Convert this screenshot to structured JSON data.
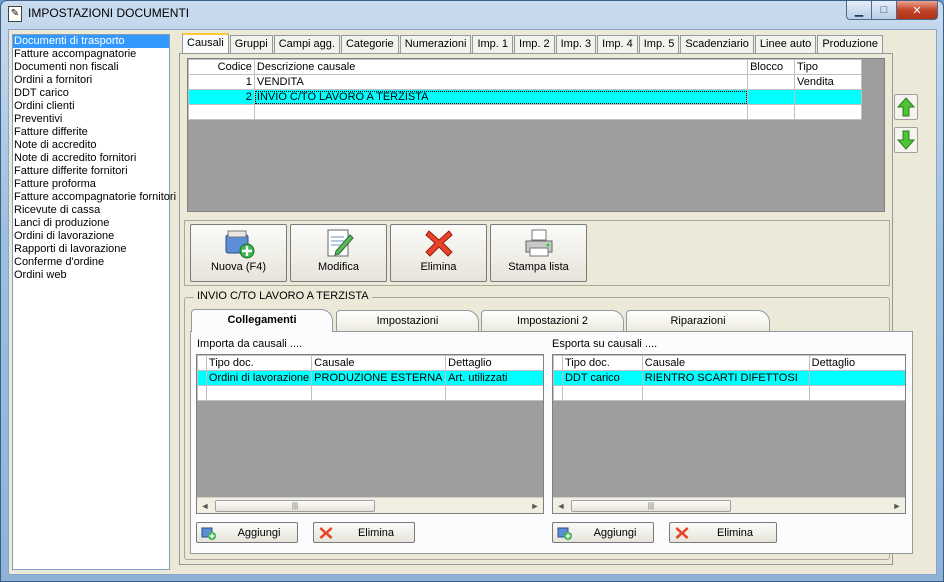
{
  "window": {
    "title": "IMPOSTAZIONI DOCUMENTI",
    "minimize_glyph": "▁",
    "maximize_glyph": "□",
    "close_glyph": "✕"
  },
  "doc_types": [
    "Documenti di trasporto",
    "Fatture accompagnatorie",
    "Documenti non fiscali",
    "Ordini a fornitori",
    "DDT carico",
    "Ordini clienti",
    "Preventivi",
    "Fatture differite",
    "Note di accredito",
    "Note di accredito fornitori",
    "Fatture differite fornitori",
    "Fatture proforma",
    "Fatture accompagnatorie fornitori",
    "Ricevute di cassa",
    "Lanci di produzione",
    "Ordini di lavorazione",
    "Rapporti di lavorazione",
    "Conferme d'ordine",
    "Ordini web"
  ],
  "selected_doc_type": "Documenti di trasporto",
  "tabs": [
    "Causali",
    "Gruppi",
    "Campi agg.",
    "Categorie",
    "Numerazioni",
    "Imp. 1",
    "Imp. 2",
    "Imp. 3",
    "Imp. 4",
    "Imp. 5",
    "Scadenziario",
    "Linee auto",
    "Produzione"
  ],
  "active_tab": "Causali",
  "causali": {
    "columns": [
      "Codice",
      "Descrizione causale",
      "Blocco",
      "Tipo"
    ],
    "rows": [
      {
        "codice": "1",
        "descrizione": "VENDITA",
        "blocco": "",
        "tipo": "Vendita"
      },
      {
        "codice": "2",
        "descrizione": "INVIO C/TO LAVORO A TERZISTA",
        "blocco": "",
        "tipo": ""
      }
    ]
  },
  "toolbar": {
    "nuova": "Nuova (F4)",
    "modifica": "Modifica",
    "elimina": "Elimina",
    "stampa": "Stampa lista"
  },
  "group_title": "INVIO C/TO LAVORO A TERZISTA",
  "subtabs": [
    "Collegamenti",
    "Impostazioni",
    "Impostazioni 2",
    "Riparazioni"
  ],
  "active_subtab": "Collegamenti",
  "importa": {
    "label": "Importa da causali ....",
    "columns": [
      "Tipo doc.",
      "Causale",
      "Dettaglio"
    ],
    "rows": [
      {
        "tipo": "Ordini di lavorazione",
        "causale": "PRODUZIONE ESTERNA",
        "dettaglio": "Art. utilizzati"
      }
    ],
    "add": "Aggiungi",
    "remove": "Elimina"
  },
  "esporta": {
    "label": "Esporta su causali ....",
    "columns": [
      "Tipo doc.",
      "Causale",
      "Dettaglio"
    ],
    "rows": [
      {
        "tipo": "DDT carico",
        "causale": "RIENTRO SCARTI DIFETTOSI",
        "dettaglio": ""
      }
    ],
    "add": "Aggiungi",
    "remove": "Elimina"
  },
  "scroll_glyphs": {
    "left": "◄",
    "right": "►",
    "grip": "|||"
  },
  "colors": {
    "selection": "#3399ff",
    "row_highlight": "#00ffff",
    "tab_accent": "#ffc83c"
  }
}
